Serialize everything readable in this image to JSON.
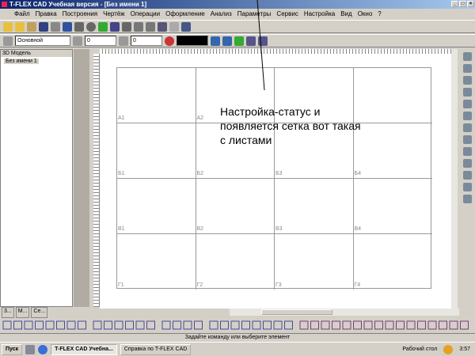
{
  "window": {
    "title": "T-FLEX CAD Учебная версия - [Без имени 1]"
  },
  "menu": [
    "Файл",
    "Правка",
    "Построения",
    "Чертёж",
    "Операции",
    "Оформление",
    "Анализ",
    "Параметры",
    "Сервис",
    "Настройка",
    "Вид",
    "Окно",
    "?"
  ],
  "toolbar2": {
    "layer": "Основной",
    "level": "0",
    "priority": "0"
  },
  "left_panel": {
    "title": "3D Модель",
    "item": "Без имени 1"
  },
  "sheet": {
    "rows": [
      [
        "А1",
        "А2",
        "",
        ""
      ],
      [
        "Б1",
        "Б2",
        "Б3",
        "Б4"
      ],
      [
        "В1",
        "В2",
        "В3",
        "В4"
      ],
      [
        "Г1",
        "Г2",
        "Г3",
        "Г4"
      ]
    ]
  },
  "annotation": [
    "Настройка-статус и",
    "появляется сетка вот такая",
    "с листами"
  ],
  "tabs": [
    "3...",
    "М...",
    "Се..."
  ],
  "status": "Задайте команду или выберите элемент",
  "taskbar": {
    "start": "Пуск",
    "tasks": [
      "T-FLEX CAD Учебна...",
      "Справка по T-FLEX CAD"
    ],
    "desktop": "Рабочий стол",
    "clock": "3:57"
  },
  "colors": {
    "titlebar": "#0a246a",
    "face": "#d4d0c8"
  }
}
